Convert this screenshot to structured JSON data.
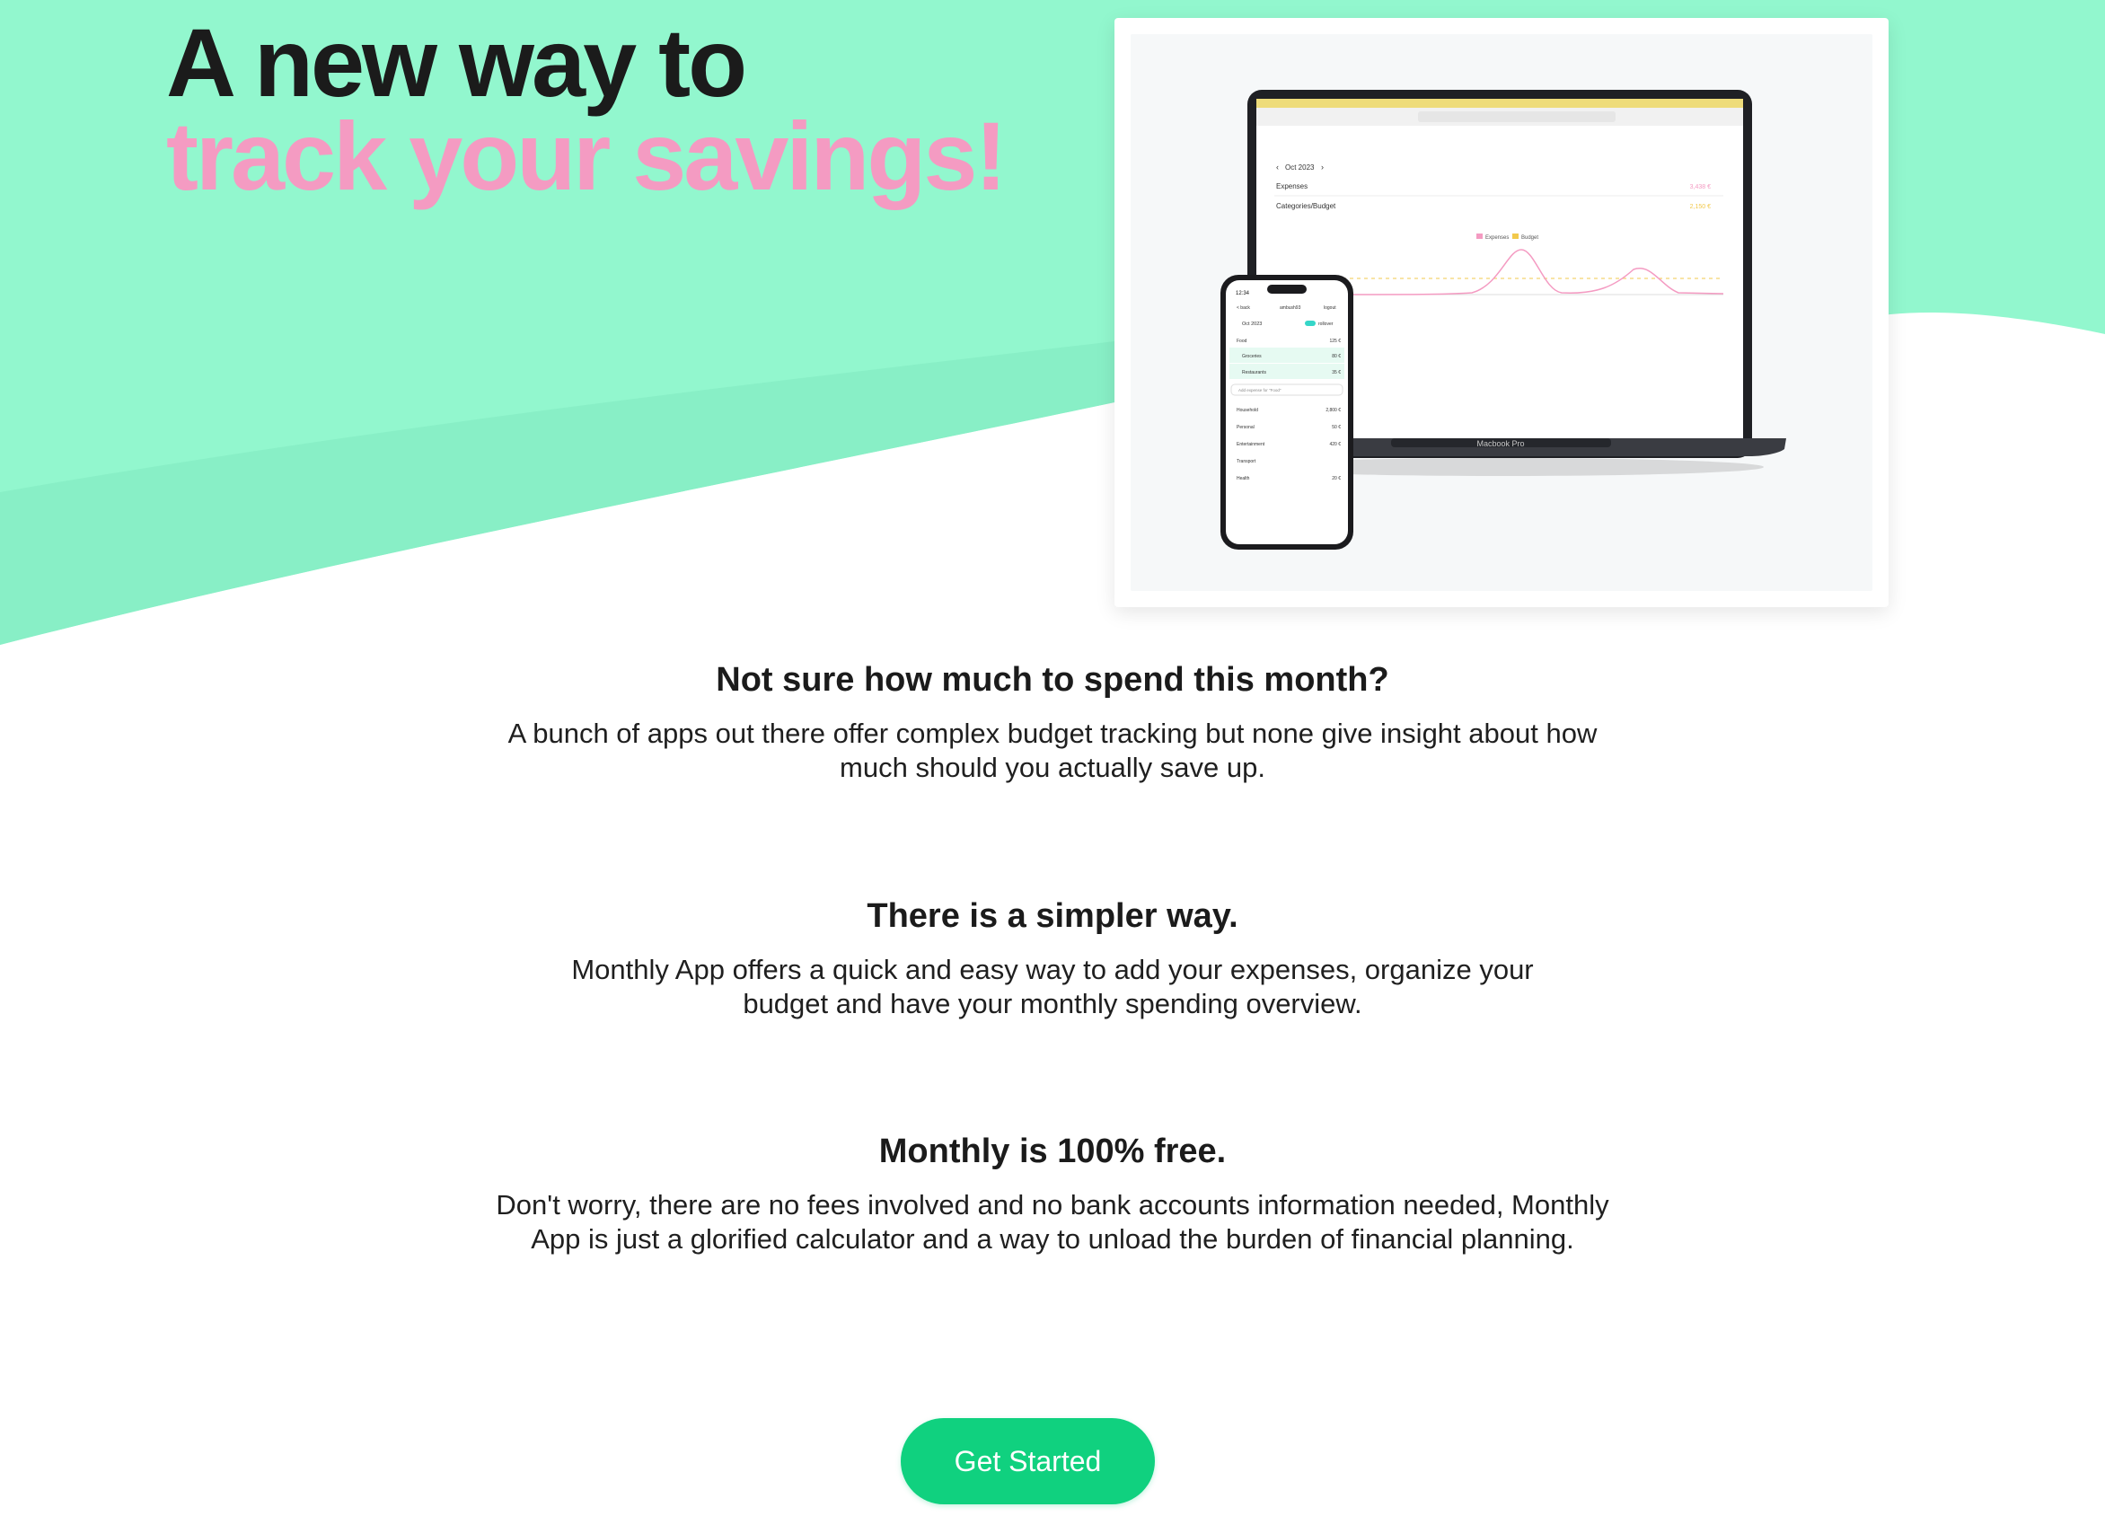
{
  "hero": {
    "headline_line1": "A new way to",
    "headline_line2": "track your savings!",
    "headline_accent_color": "#f49bc2",
    "background_color": "#92f7ce"
  },
  "showcase": {
    "laptop_label": "Macbook Pro",
    "laptop_screen": {
      "month": "Oct 2023",
      "rows": [
        {
          "label": "Expenses",
          "value": "3,438 €",
          "color": "#f49bc2"
        },
        {
          "label": "Categories/Budget",
          "value": "2,150 €",
          "color": "#f2c94c"
        }
      ],
      "legend": [
        "Expenses",
        "Budget"
      ]
    },
    "phone_screen": {
      "time": "12:34",
      "tabs": [
        "< back",
        "ambush93",
        "logout"
      ],
      "month": "Oct 2023",
      "toggle_label": "rollover",
      "rows": [
        {
          "label": "Food",
          "value": "125 €"
        },
        {
          "label": "Groceries",
          "value": "80 €"
        },
        {
          "label": "Restaurants",
          "value": "35 €"
        },
        {
          "label": "Add expense for \"Food\"",
          "value": ""
        },
        {
          "label": "Household",
          "value": "2,800 €"
        },
        {
          "label": "Personal",
          "value": "50 €"
        },
        {
          "label": "Entertainment",
          "value": "420 €"
        },
        {
          "label": "Transport",
          "value": ""
        },
        {
          "label": "Health",
          "value": "20 €"
        }
      ]
    }
  },
  "sections": [
    {
      "heading": "Not sure how much to spend this month?",
      "body": "A bunch of apps out there offer complex budget tracking but none give insight about how much should you actually save up."
    },
    {
      "heading": "There is a simpler way.",
      "body": "Monthly App offers a quick and easy way to add your expenses, organize your budget and have your monthly spending overview."
    },
    {
      "heading": "Monthly is 100% free.",
      "body": "Don't worry, there are no fees involved and no bank accounts information needed, Monthly App is just a glorified calculator and a way to unload the burden of financial planning."
    }
  ],
  "cta": {
    "label": "Get Started",
    "color": "#10d17f"
  }
}
